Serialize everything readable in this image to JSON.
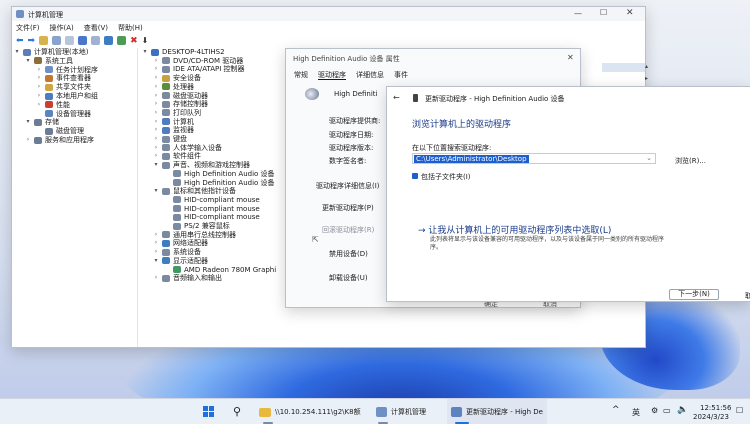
{
  "main_window": {
    "title": "计算机管理",
    "menu": [
      "文件(F)",
      "操作(A)",
      "查看(V)",
      "帮助(H)"
    ],
    "left_tree": [
      {
        "label": "计算机管理(本地)",
        "indent": 0,
        "exp": "▾",
        "color": "#5b7db8"
      },
      {
        "label": "系统工具",
        "indent": 1,
        "exp": "▾",
        "color": "#8a6d3b"
      },
      {
        "label": "任务计划程序",
        "indent": 2,
        "exp": "›",
        "color": "#6f8fc5"
      },
      {
        "label": "事件查看器",
        "indent": 2,
        "exp": "›",
        "color": "#c5772f"
      },
      {
        "label": "共享文件夹",
        "indent": 2,
        "exp": "›",
        "color": "#d3a441"
      },
      {
        "label": "本地用户和组",
        "indent": 2,
        "exp": "›",
        "color": "#4f7bc0"
      },
      {
        "label": "性能",
        "indent": 2,
        "exp": "›",
        "color": "#c8412f"
      },
      {
        "label": "设备管理器",
        "indent": 2,
        "exp": "",
        "color": "#5d83c0"
      },
      {
        "label": "存储",
        "indent": 1,
        "exp": "▾",
        "color": "#6b7c96"
      },
      {
        "label": "磁盘管理",
        "indent": 2,
        "exp": "",
        "color": "#6b7c96"
      },
      {
        "label": "服务和应用程序",
        "indent": 1,
        "exp": "›",
        "color": "#6b7c96"
      }
    ],
    "device_tree": [
      {
        "label": "DESKTOP-4LTIHS2",
        "indent": 0,
        "exp": "▾",
        "color": "#3c6fc2"
      },
      {
        "label": "DVD/CD-ROM 驱动器",
        "indent": 1,
        "exp": "›",
        "color": "#7b8aa0"
      },
      {
        "label": "IDE ATA/ATAPI 控制器",
        "indent": 1,
        "exp": "›",
        "color": "#7b8aa0"
      },
      {
        "label": "安全设备",
        "indent": 1,
        "exp": "›",
        "color": "#c8a23c"
      },
      {
        "label": "处理器",
        "indent": 1,
        "exp": "›",
        "color": "#5c8f3c"
      },
      {
        "label": "磁盘驱动器",
        "indent": 1,
        "exp": "›",
        "color": "#7b8aa0"
      },
      {
        "label": "存储控制器",
        "indent": 1,
        "exp": "›",
        "color": "#7b8aa0"
      },
      {
        "label": "打印队列",
        "indent": 1,
        "exp": "›",
        "color": "#7b8aa0"
      },
      {
        "label": "计算机",
        "indent": 1,
        "exp": "›",
        "color": "#4f7bc0"
      },
      {
        "label": "监视器",
        "indent": 1,
        "exp": "›",
        "color": "#4f7bc0"
      },
      {
        "label": "键盘",
        "indent": 1,
        "exp": "›",
        "color": "#7b8aa0"
      },
      {
        "label": "人体学输入设备",
        "indent": 1,
        "exp": "›",
        "color": "#7b8aa0"
      },
      {
        "label": "软件组件",
        "indent": 1,
        "exp": "›",
        "color": "#7b8aa0"
      },
      {
        "label": "声音、视频和游戏控制器",
        "indent": 1,
        "exp": "▾",
        "color": "#7b8aa0"
      },
      {
        "label": "High Definition Audio 设备",
        "indent": 2,
        "exp": "",
        "color": "#7b8aa0"
      },
      {
        "label": "High Definition Audio 设备",
        "indent": 2,
        "exp": "",
        "color": "#7b8aa0"
      },
      {
        "label": "鼠标和其他指针设备",
        "indent": 1,
        "exp": "▾",
        "color": "#7b8aa0"
      },
      {
        "label": "HID-compliant mouse",
        "indent": 2,
        "exp": "",
        "color": "#7b8aa0"
      },
      {
        "label": "HID-compliant mouse",
        "indent": 2,
        "exp": "",
        "color": "#7b8aa0"
      },
      {
        "label": "HID-compliant mouse",
        "indent": 2,
        "exp": "",
        "color": "#7b8aa0"
      },
      {
        "label": "PS/2 兼容鼠标",
        "indent": 2,
        "exp": "",
        "color": "#7b8aa0"
      },
      {
        "label": "通用串行总线控制器",
        "indent": 1,
        "exp": "›",
        "color": "#7b8aa0"
      },
      {
        "label": "网络适配器",
        "indent": 1,
        "exp": "›",
        "color": "#3f7dc2"
      },
      {
        "label": "系统设备",
        "indent": 1,
        "exp": "›",
        "color": "#7b8aa0"
      },
      {
        "label": "显示适配器",
        "indent": 1,
        "exp": "▾",
        "color": "#3f7dc2"
      },
      {
        "label": "AMD Radeon 780M Graphi",
        "indent": 2,
        "exp": "",
        "color": "#3f9a64"
      },
      {
        "label": "音频输入和输出",
        "indent": 1,
        "exp": "›",
        "color": "#7b8aa0"
      }
    ]
  },
  "props": {
    "title": "High Definition Audio 设备 属性",
    "tabs": [
      "常规",
      "驱动程序",
      "详细信息",
      "事件"
    ],
    "device_name": "High Definiti",
    "fields": [
      "驱动程序提供商:",
      "驱动程序日期:",
      "驱动程序版本:",
      "数字签名者:"
    ],
    "buttons": [
      "驱动程序详细信息(I)",
      "更新驱动程序(P)",
      "回滚驱动程序(R)",
      "禁用设备(D)",
      "卸载设备(U)"
    ],
    "ok": "确定",
    "cancel": "取消"
  },
  "update": {
    "title": "更新驱动程序 - High Definition Audio 设备",
    "heading": "浏览计算机上的驱动程序",
    "search_label": "在以下位置搜索驱动程序:",
    "path": "C:\\Users\\Administrator\\Desktop",
    "browse": "浏览(R)...",
    "include_sub": "包括子文件夹(I)",
    "pick_link": "→  让我从计算机上的可用驱动程序列表中选取(L)",
    "pick_desc1": "此列表将显示与该设备兼容的可用驱动程序，以及与该设备属于同一类别的所有驱动程序",
    "pick_desc2": "序。",
    "next": "下一步(N)",
    "cancel_cut": "取"
  },
  "taskbar": {
    "path": "\\\\10.10.254.111\\g2\\K8额",
    "app1": "计算机管理",
    "app2": "更新驱动程序 - High De",
    "ime": "英",
    "time": "12:51:56",
    "date": "2024/3/23"
  }
}
